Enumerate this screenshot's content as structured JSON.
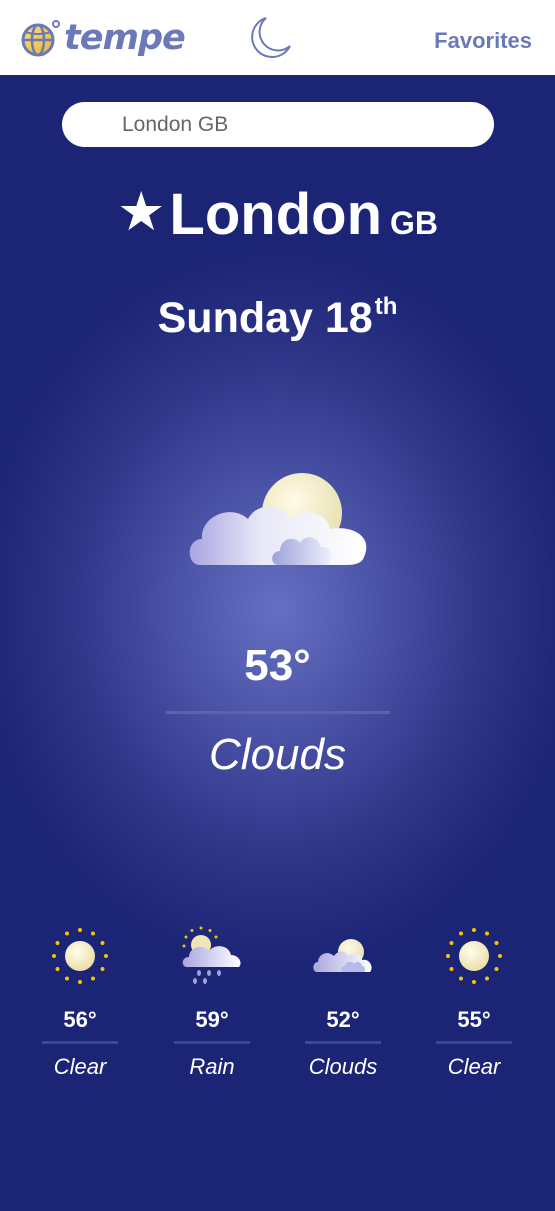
{
  "header": {
    "logo_text": "tempe",
    "favorites_label": "Favorites"
  },
  "search": {
    "value": "London GB"
  },
  "location": {
    "city": "London",
    "country": "GB"
  },
  "date": {
    "day": "Sunday 18",
    "suffix": "th"
  },
  "current": {
    "temperature": "53°",
    "condition": "Clouds",
    "icon": "clouds-icon"
  },
  "forecast": [
    {
      "temperature": "56°",
      "condition": "Clear",
      "icon": "sun-icon"
    },
    {
      "temperature": "59°",
      "condition": "Rain",
      "icon": "rain-icon"
    },
    {
      "temperature": "52°",
      "condition": "Clouds",
      "icon": "clouds-icon"
    },
    {
      "temperature": "55°",
      "condition": "Clear",
      "icon": "sun-icon"
    }
  ],
  "colors": {
    "header_bg": "#ffffff",
    "brand": "#6a7ab8",
    "main_bg": "#1b2473",
    "sun_rays": "#f5c400"
  }
}
